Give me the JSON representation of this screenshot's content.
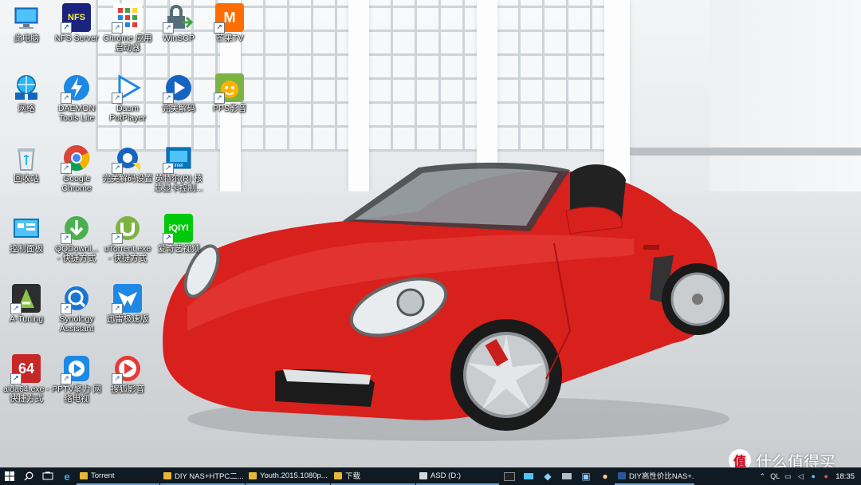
{
  "desktop": {
    "icons": [
      {
        "label": "此电脑",
        "icon": "computer-icon",
        "shortcut": false
      },
      {
        "label": "NFS Server",
        "icon": "nfs-icon",
        "shortcut": true
      },
      {
        "label": "Chrome 应用\n启动器",
        "icon": "chrome-apps-icon",
        "shortcut": true
      },
      {
        "label": "WinSCP",
        "icon": "winscp-icon",
        "shortcut": true
      },
      {
        "label": "芒果TV",
        "icon": "mango-tv-icon",
        "shortcut": true
      },
      {
        "label": "网络",
        "icon": "network-icon",
        "shortcut": false
      },
      {
        "label": "DAEMON\nTools Lite",
        "icon": "daemon-tools-icon",
        "shortcut": true
      },
      {
        "label": "Daum\nPotPlayer",
        "icon": "potplayer-icon",
        "shortcut": true
      },
      {
        "label": "完美解码",
        "icon": "perfect-decoder-icon",
        "shortcut": true
      },
      {
        "label": "PPS影音",
        "icon": "pps-icon",
        "shortcut": true
      },
      {
        "label": "回收站",
        "icon": "recycle-bin-icon",
        "shortcut": false
      },
      {
        "label": "Google\nChrome",
        "icon": "chrome-icon",
        "shortcut": true
      },
      {
        "label": "完美解码设置",
        "icon": "decoder-settings-icon",
        "shortcut": true
      },
      {
        "label": "英特尔(R) 核\n芯显卡控制...",
        "icon": "intel-graphics-icon",
        "shortcut": true
      },
      {
        "label": "控制面板",
        "icon": "control-panel-icon",
        "shortcut": false
      },
      {
        "label": "QQDownl...\n- 快捷方式",
        "icon": "qqdownload-icon",
        "shortcut": true
      },
      {
        "label": "uTorrent.exe\n- 快捷方式",
        "icon": "utorrent-icon",
        "shortcut": true
      },
      {
        "label": "爱奇艺视频",
        "icon": "iqiyi-icon",
        "shortcut": true
      },
      {
        "label": "A-Tuning",
        "icon": "a-tuning-icon",
        "shortcut": true
      },
      {
        "label": "Synology\nAssistant",
        "icon": "synology-assistant-icon",
        "shortcut": true
      },
      {
        "label": "迅雷极速版",
        "icon": "thunder-icon",
        "shortcut": true
      },
      {
        "label": "aida64.exe -\n快捷方式",
        "icon": "aida64-icon",
        "shortcut": true
      },
      {
        "label": "PPTV聚力 网\n络电视",
        "icon": "pptv-icon",
        "shortcut": true
      },
      {
        "label": "搜狐影音",
        "icon": "sohu-video-icon",
        "shortcut": true
      }
    ]
  },
  "taskbar": {
    "apps": [
      {
        "label": "Torrent"
      },
      {
        "label": "DIY NAS+HTPC二..."
      },
      {
        "label": "Youth.2015.1080p..."
      },
      {
        "label": "下载"
      },
      {
        "label": "ASD (D:)"
      },
      {
        "label": "DIY高性价比NAS+..."
      }
    ],
    "tray_text": "QL",
    "clock": "18:35"
  },
  "watermark": {
    "text": "什么值得买",
    "badge": "值"
  },
  "colors": {
    "taskbar": "#101a22",
    "car": "#d8201c",
    "accent": "#6da4d6"
  }
}
